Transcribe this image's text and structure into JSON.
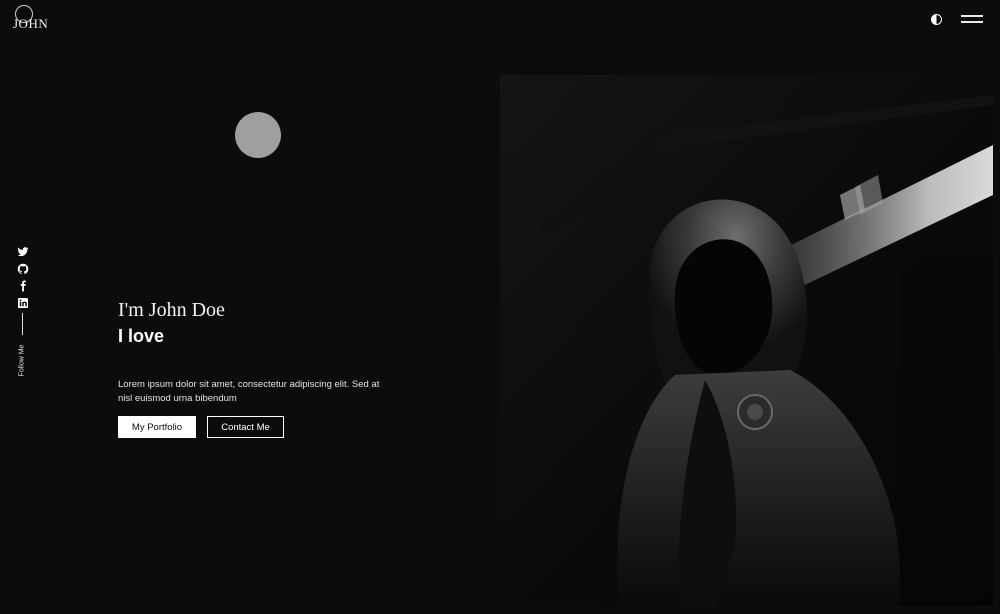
{
  "header": {
    "logo_text": "JOHN",
    "theme_toggle_icon": "half-circle-icon",
    "menu_icon": "hamburger-icon"
  },
  "social": {
    "items": [
      {
        "name": "twitter",
        "icon": "twitter-icon"
      },
      {
        "name": "github",
        "icon": "github-icon"
      },
      {
        "name": "facebook",
        "icon": "facebook-icon"
      },
      {
        "name": "linkedin",
        "icon": "linkedin-icon"
      }
    ],
    "follow_label": "Follow Me"
  },
  "hero": {
    "greeting": "I'm John Doe",
    "tagline": "I love",
    "intro": "Lorem ipsum dolor sit amet, consectetur adipiscing elit. Sed at nisl euismod urna bibendum",
    "portfolio_button": "My Portfolio",
    "contact_button": "Contact Me"
  },
  "colors": {
    "background": "#0c0c0c",
    "text": "#ffffff",
    "accent_circle": "#9f9f9f"
  }
}
